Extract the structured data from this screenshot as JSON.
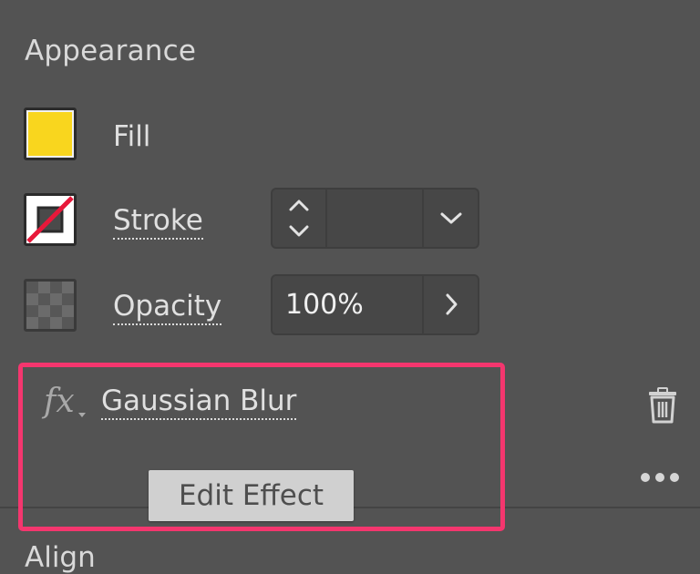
{
  "panel": {
    "title": "Appearance",
    "fill_label": "Fill",
    "stroke_label": "Stroke",
    "opacity_label": "Opacity",
    "opacity_value": "100%",
    "effect_label": "Gaussian Blur",
    "tooltip": "Edit Effect",
    "next_section": "Align"
  },
  "icons": {
    "fx": "fx",
    "trash": "trash-icon",
    "more": "more-options-icon"
  },
  "colors": {
    "panel_bg": "#535353",
    "fill_color": "#f9d61e",
    "highlight": "#f4366e",
    "stroke_none": "#e8183a"
  }
}
